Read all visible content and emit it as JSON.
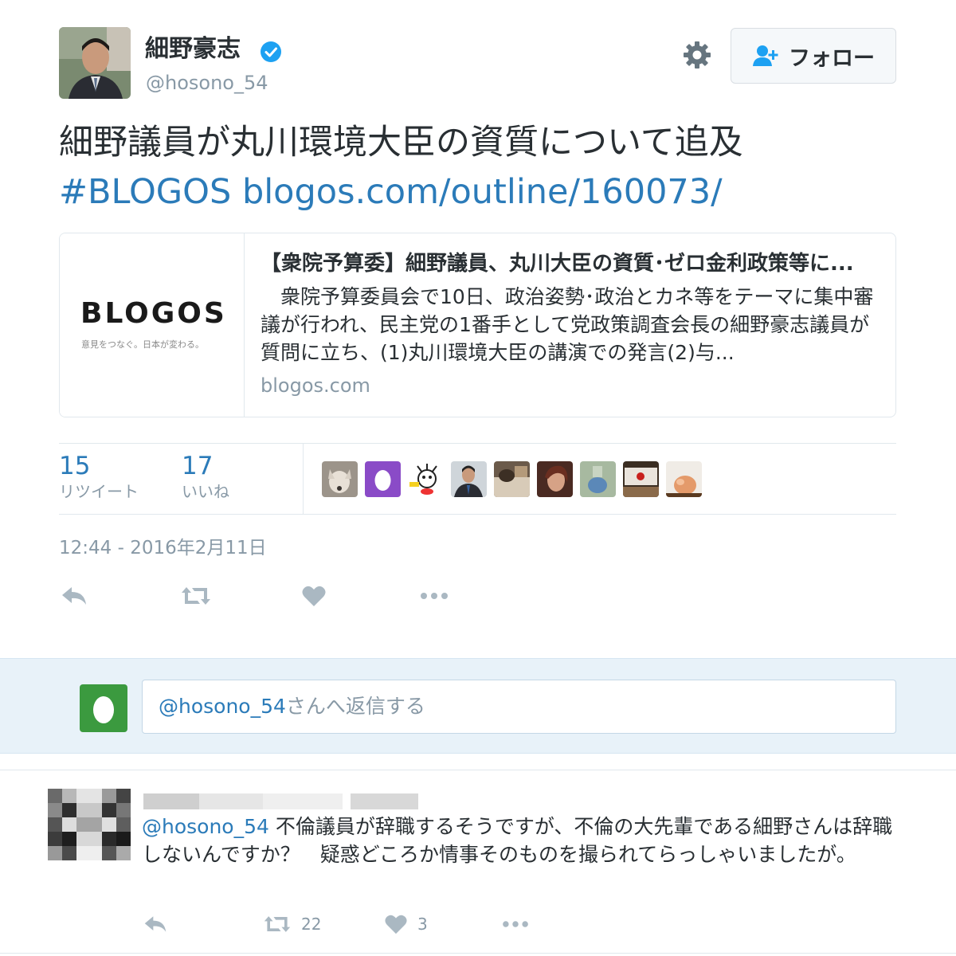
{
  "tweet": {
    "display_name": "細野豪志",
    "handle": "@hosono_54",
    "follow_label": "フォロー",
    "text_line1": "細野議員が丸川環境大臣の資質について追及",
    "hashtag": "#BLOGOS",
    "url": "blogos.com/outline/160073/",
    "card": {
      "logo": "BLOGOS",
      "tagline": "意見をつなぐ。日本が変わる。",
      "title": "【衆院予算委】細野議員、丸川大臣の資質･ゼロ金利政策等に...",
      "description": "　衆院予算委員会で10日、政治姿勢･政治とカネ等をテーマに集中審議が行われ、民主党の1番手として党政策調査会長の細野豪志議員が質問に立ち、(1)丸川環境大臣の講演での発言(2)与...",
      "domain": "blogos.com"
    },
    "stats": {
      "retweets": "15",
      "retweets_label": "リツイート",
      "likes": "17",
      "likes_label": "いいね"
    },
    "timestamp": "12:44 - 2016年2月11日"
  },
  "reply_box": {
    "mention": "@hosono_54",
    "placeholder_rest": "さんへ返信する"
  },
  "reply_tweet": {
    "mention": "@hosono_54",
    "text": " 不倫議員が辞職するそうですが、不倫の大先輩である細野さんは辞職しないんですか？　疑惑どころか情事そのものを撮られてらっしゃいましたが。",
    "retweets": "22",
    "likes": "3"
  },
  "colors": {
    "link": "#2b7bb9",
    "muted": "#8899a6",
    "border": "#e1e8ed",
    "reply_bg": "#e8f2f9"
  }
}
